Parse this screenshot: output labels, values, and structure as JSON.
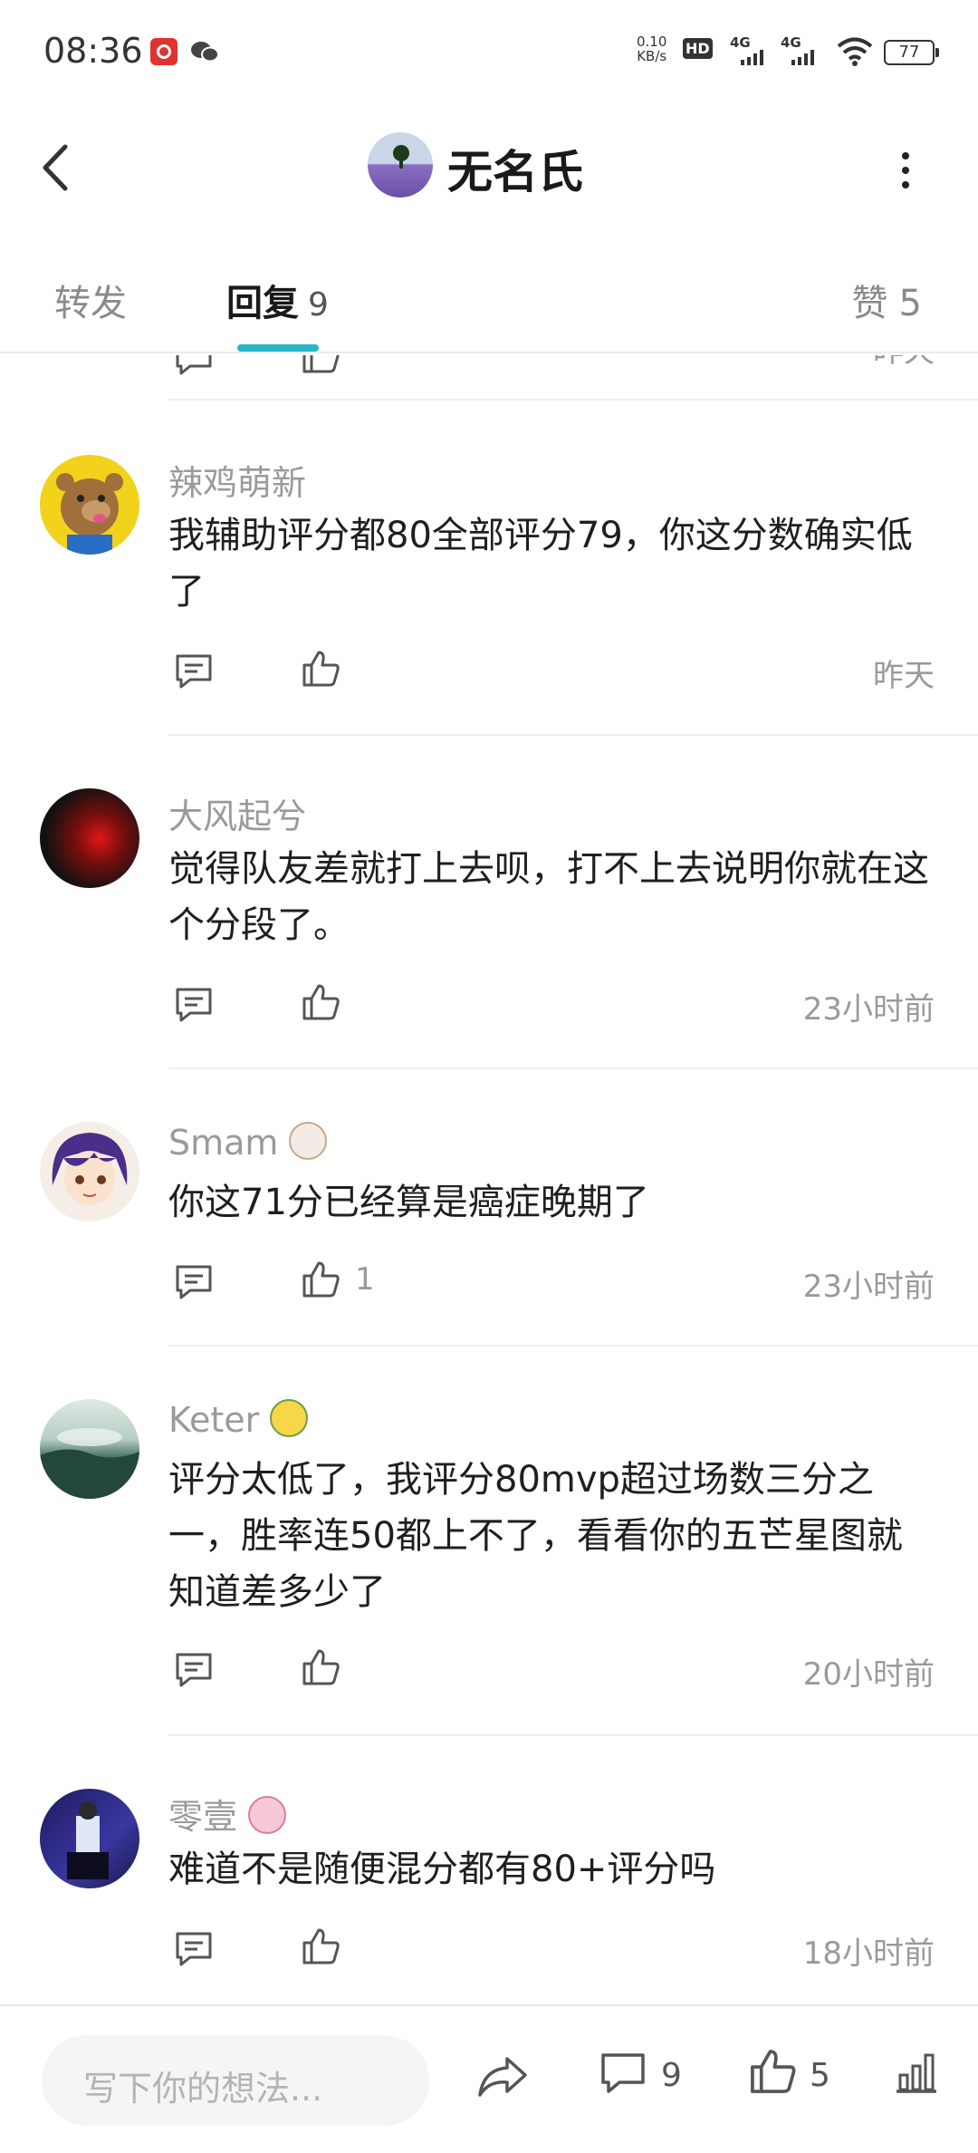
{
  "status_bar": {
    "time": "08:36",
    "net_speed_value": "0.10",
    "net_speed_unit": "KB/s",
    "hd_label": "HD",
    "network_1": "4G",
    "network_2": "4G",
    "battery": "77"
  },
  "header": {
    "title": "无名氏"
  },
  "tabs": {
    "forward": "转发",
    "reply": "回复",
    "reply_count": "9",
    "likes": "赞",
    "likes_count": "5"
  },
  "previous_item": {
    "time": "昨天"
  },
  "comments": [
    {
      "name": "辣鸡萌新",
      "text": "我辅助评分都80全部评分79，你这分数确实低了",
      "like_count": "",
      "time": "昨天"
    },
    {
      "name": "大风起兮",
      "text": "觉得队友差就打上去呗，打不上去说明你就在这个分段了。",
      "like_count": "",
      "time": "23小时前"
    },
    {
      "name": "Smam",
      "text": "你这71分已经算是癌症晚期了",
      "like_count": "1",
      "time": "23小时前"
    },
    {
      "name": "Keter",
      "text": "评分太低了，我评分80mvp超过场数三分之一，胜率连50都上不了，看看你的五芒星图就知道差多少了",
      "like_count": "",
      "time": "20小时前"
    },
    {
      "name": "零壹",
      "text": "难道不是随便混分都有80+评分吗",
      "like_count": "",
      "time": "18小时前"
    }
  ],
  "bottom_bar": {
    "input_placeholder": "写下你的想法...",
    "comment_count": "9",
    "like_count": "5"
  },
  "colors": {
    "accent": "#2ab5c7",
    "muted_text": "#9a9a9a",
    "body_text": "#1f1f1f"
  }
}
